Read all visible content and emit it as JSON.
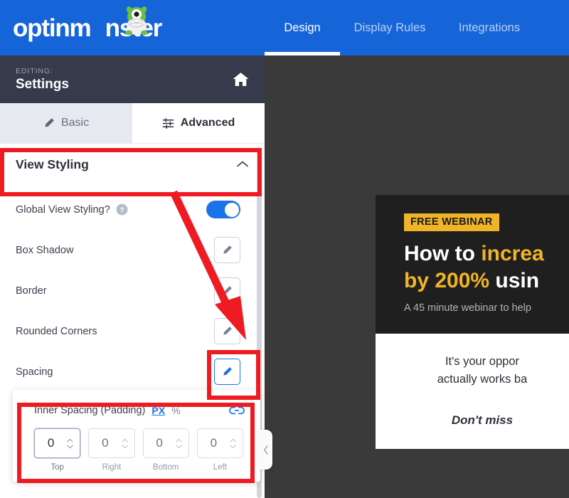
{
  "brand": {
    "logo_text_before": "optinm",
    "logo_text_after": "nster",
    "logo_icon": "monster-mascot-icon",
    "blue": "#1665d8",
    "accent_yellow": "#f0b429",
    "annotation_red": "#ee1c22",
    "toggle_blue": "#1a73e8"
  },
  "topnav": {
    "items": [
      {
        "label": "Design",
        "active": true
      },
      {
        "label": "Display Rules",
        "active": false
      },
      {
        "label": "Integrations",
        "active": false
      }
    ]
  },
  "panel": {
    "editing_label": "EDITING:",
    "editing_name": "Settings",
    "home_icon": "home-icon",
    "tabs": [
      {
        "label": "Basic",
        "icon": "pencil-icon",
        "active": false
      },
      {
        "label": "Advanced",
        "icon": "sliders-icon",
        "active": true
      }
    ],
    "section": {
      "title": "View Styling",
      "chevron": "chevron-up-icon",
      "expanded": true
    },
    "rows": [
      {
        "label": "Global View Styling?",
        "help_icon": "question-mark-icon",
        "control": "toggle",
        "toggle_on": true
      },
      {
        "label": "Box Shadow",
        "control": "edit-button",
        "icon": "pencil-icon",
        "focused": false
      },
      {
        "label": "Border",
        "control": "edit-button",
        "icon": "pencil-icon",
        "focused": false
      },
      {
        "label": "Rounded Corners",
        "control": "edit-button",
        "icon": "pencil-icon",
        "focused": false
      },
      {
        "label": "Spacing",
        "control": "edit-button",
        "icon": "pencil-icon",
        "focused": true
      }
    ]
  },
  "spacing_card": {
    "title": "Inner Spacing (Padding)",
    "unit_px": "PX",
    "unit_percent": "%",
    "unit_active": "PX",
    "link_icon": "chain-link-icon",
    "fields": [
      {
        "label": "Top",
        "value": "0",
        "focused": true
      },
      {
        "label": "Right",
        "value": "0",
        "focused": false
      },
      {
        "label": "Bottom",
        "value": "0",
        "focused": false
      },
      {
        "label": "Left",
        "value": "0",
        "focused": false
      }
    ]
  },
  "collapse_handle": {
    "icon": "chevron-left-icon"
  },
  "preview": {
    "badge": "FREE WEBINAR",
    "headline_line1_white": "How to ",
    "headline_line1_accent": "increa",
    "headline_line2_accent": "by 200% ",
    "headline_line2_white": "usin",
    "subhead": "A 45 minute webinar to help",
    "body_line1": "It's your oppor",
    "body_line2": "actually works ba",
    "cta": "Don't miss"
  }
}
